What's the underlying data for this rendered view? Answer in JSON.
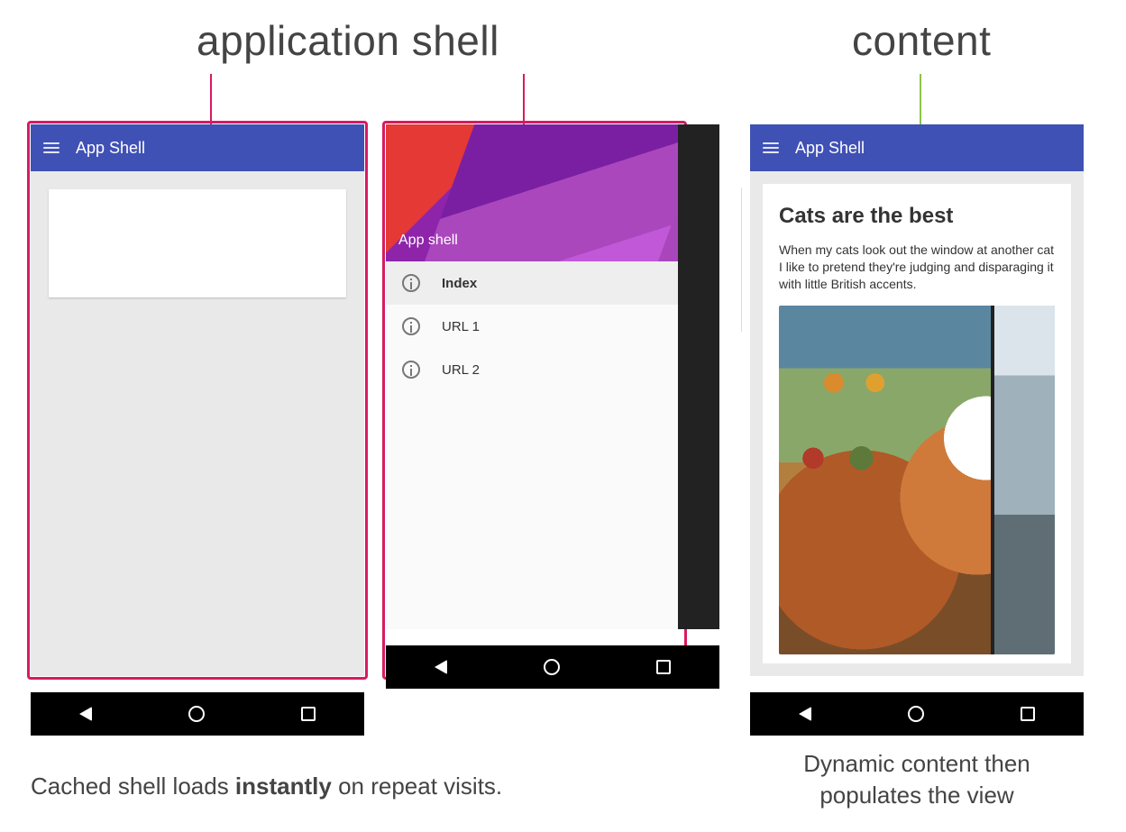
{
  "labels": {
    "shell": "application shell",
    "content": "content"
  },
  "appbar": {
    "title": "App Shell"
  },
  "drawer": {
    "header_title": "App shell",
    "items": [
      {
        "label": "Index",
        "active": true
      },
      {
        "label": "URL 1",
        "active": false
      },
      {
        "label": "URL 2",
        "active": false
      }
    ]
  },
  "article": {
    "title": "Cats are the best",
    "body": "When my cats look out the window at another cat I like to pretend they're judging and disparaging it with little British accents."
  },
  "captions": {
    "left_pre": "Cached shell loads ",
    "left_strong": "instantly",
    "left_post": " on repeat visits.",
    "right": "Dynamic content then populates the view"
  },
  "icons": {
    "hamburger": "hamburger-icon",
    "info": "info-icon",
    "nav_back": "nav-back-icon",
    "nav_home": "nav-home-icon",
    "nav_recent": "nav-recent-icon"
  }
}
